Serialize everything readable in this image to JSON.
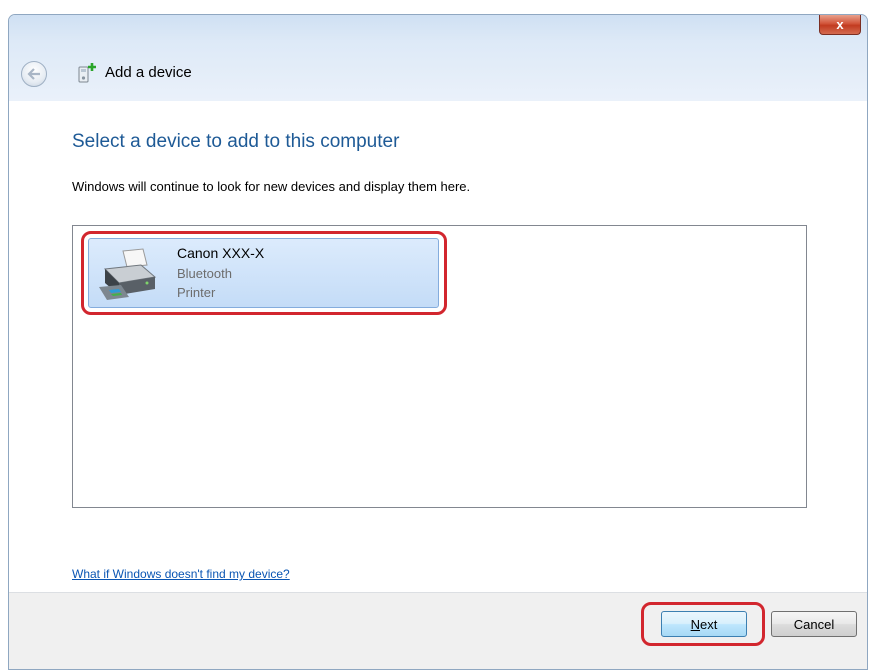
{
  "window": {
    "title": "Add a device",
    "close_label": "x"
  },
  "main": {
    "heading": "Select a device to add to this computer",
    "subtext": "Windows will continue to look for new devices and display them here.",
    "devices": [
      {
        "name": "Canon  XXX-X",
        "type": "Bluetooth",
        "category": "Printer",
        "icon": "printer-icon",
        "selected": true
      }
    ],
    "help_link": "What if Windows doesn't find my device?"
  },
  "footer": {
    "next_label_mnemonic": "N",
    "next_label_rest": "ext",
    "cancel_label": "Cancel"
  },
  "colors": {
    "heading": "#1e5a96",
    "link": "#0a55b3",
    "highlight": "#d2262e",
    "selection": "#c4dcf7"
  }
}
